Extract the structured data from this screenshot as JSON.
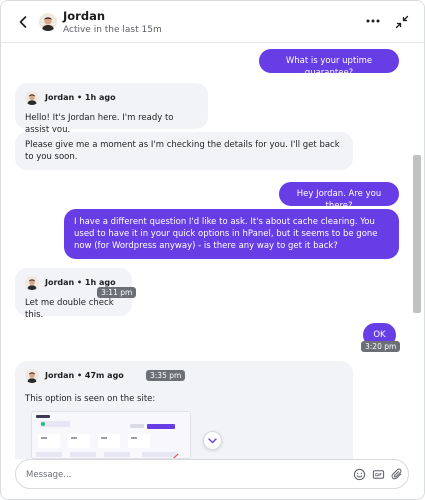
{
  "header": {
    "name": "Jordan",
    "status": "Active in the last 15m"
  },
  "messages": {
    "m1": "What is your uptime guarantee?",
    "m2_sender": "Jordan • 1h ago",
    "m2_text": "Hello! It's Jordan here. I'm ready to assist you.",
    "m3_text": "Please give me a moment as I'm checking the details for you. I'll get back to you soon.",
    "m4": "Hey Jordan. Are you there?",
    "m5": "I have a different question I'd like to ask. It's about cache clearing. You used to have it in your quick options in hPanel, but it seems to be gone now (for Wordpress anyway) - is there any way to get it back?",
    "m6_sender": "Jordan • 1h ago",
    "m6_ts": "3:11 pm",
    "m6_text": "Let me double check this.",
    "m7": "OK",
    "m7_ts": "3:20 pm",
    "m8_sender": "Jordan • 47m ago",
    "m8_ts": "3:35 pm",
    "m8_text": "This option is seen on the site:"
  },
  "composer": {
    "placeholder": "Message..."
  },
  "colors": {
    "accent": "#673de6",
    "incoming_bg": "#f2f3f6",
    "timestamp_bg": "#6d6f77"
  },
  "icons": {
    "back": "chevron-left-icon",
    "more": "more-horizontal-icon",
    "collapse": "minimize-icon",
    "emoji": "emoji-icon",
    "gif": "gif-icon",
    "attach": "paperclip-icon",
    "scroll_down": "chevron-down-icon"
  }
}
